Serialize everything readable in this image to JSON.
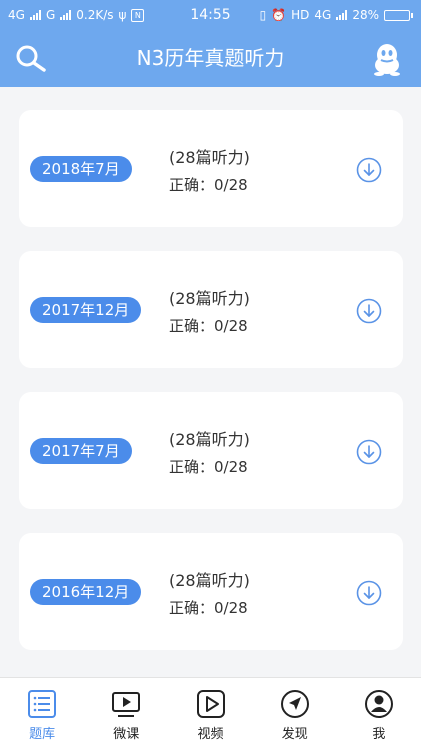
{
  "status_bar": {
    "network_1": "4G",
    "network_2": "G",
    "speed": "0.2K/s",
    "time": "14:55",
    "hd": "HD",
    "network_3": "4G",
    "battery": "28%",
    "battery_level": 0.28
  },
  "header": {
    "title": "N3历年真题听力",
    "search_icon": "search-icon",
    "qq_icon": "qq-penguin-icon"
  },
  "exams": [
    {
      "date": "2018年7月",
      "count": "(28篇听力)",
      "score": "正确：0/28"
    },
    {
      "date": "2017年12月",
      "count": "(28篇听力)",
      "score": "正确：0/28"
    },
    {
      "date": "2017年7月",
      "count": "(28篇听力)",
      "score": "正确：0/28"
    },
    {
      "date": "2016年12月",
      "count": "(28篇听力)",
      "score": "正确：0/28"
    }
  ],
  "tabs": [
    {
      "label": "题库",
      "icon": "list-icon",
      "active": true
    },
    {
      "label": "微课",
      "icon": "video-play-icon",
      "active": false
    },
    {
      "label": "视频",
      "icon": "play-icon",
      "active": false
    },
    {
      "label": "发现",
      "icon": "compass-icon",
      "active": false
    },
    {
      "label": "我",
      "icon": "user-icon",
      "active": false
    }
  ],
  "colors": {
    "header_bg": "#6ea8ee",
    "accent": "#4b8cea",
    "page_bg": "#f4f5f7"
  }
}
